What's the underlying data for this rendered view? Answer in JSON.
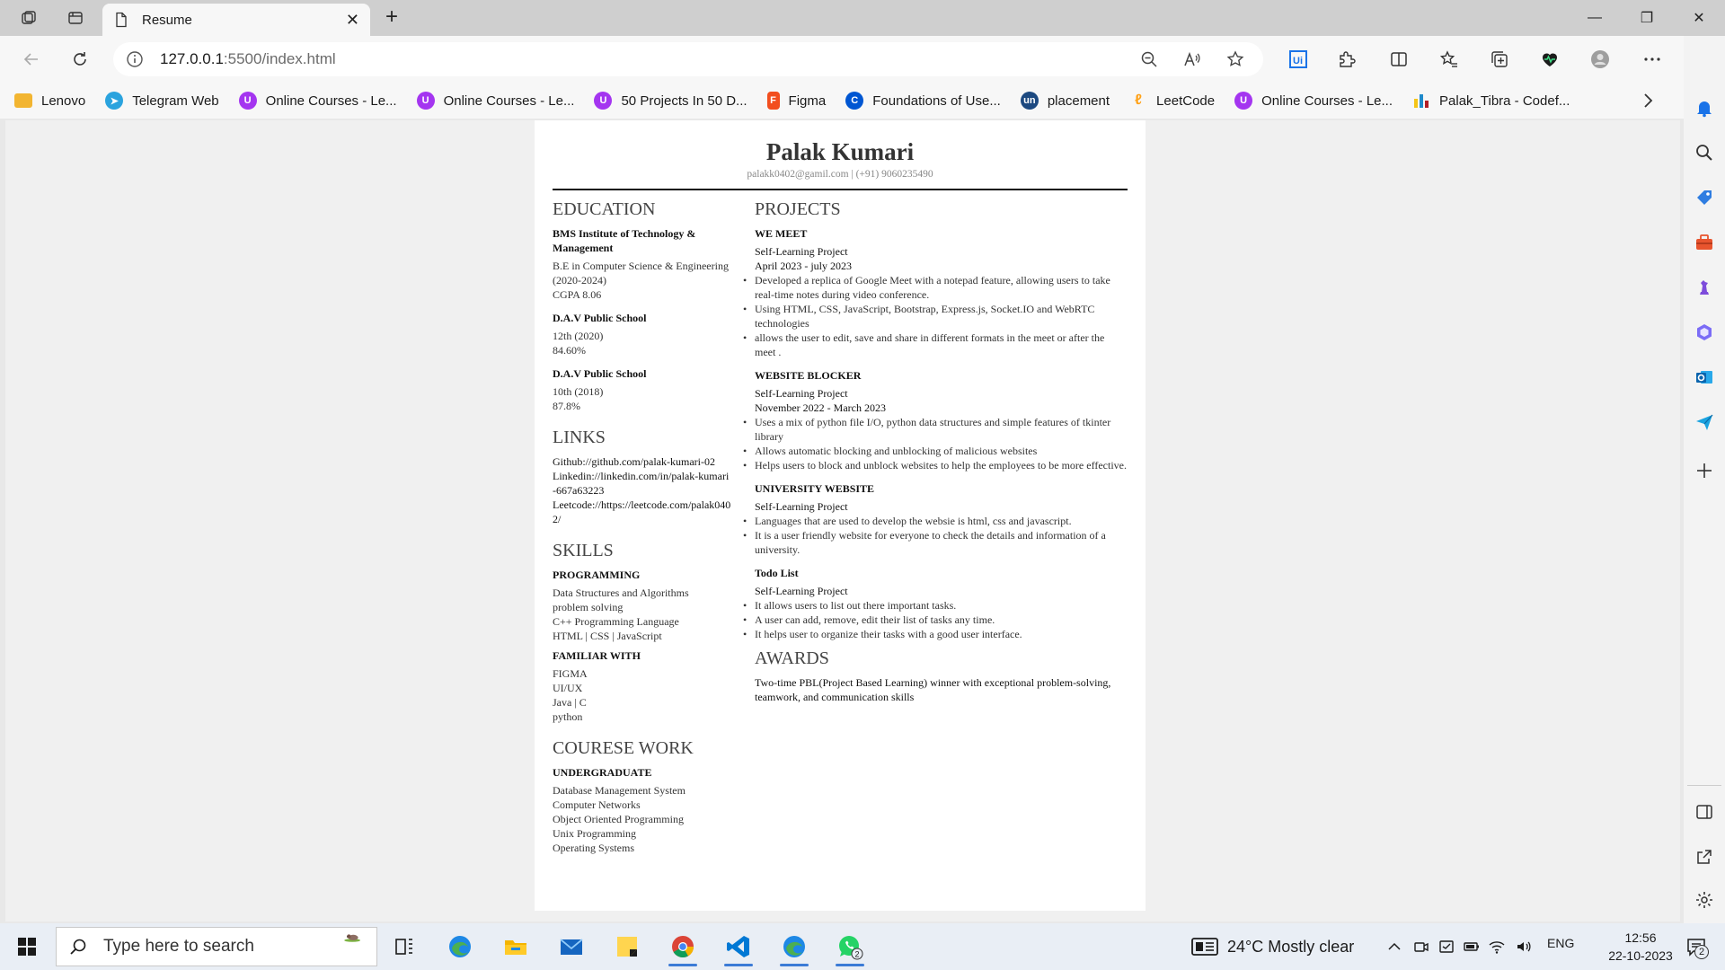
{
  "browser": {
    "tab_title": "Resume",
    "url_host": "127.0.0.1",
    "url_rest": ":5500/index.html",
    "bookmarks": [
      {
        "label": "Lenovo",
        "icon": "folder-icon",
        "color": "#f2b531"
      },
      {
        "label": "Telegram Web",
        "icon": "telegram-icon",
        "color": "#2aa3de"
      },
      {
        "label": "Online Courses - Le...",
        "icon": "udemy-icon",
        "color": "#a435f0"
      },
      {
        "label": "Online Courses - Le...",
        "icon": "udemy-icon",
        "color": "#a435f0"
      },
      {
        "label": "50 Projects In 50 D...",
        "icon": "udemy-icon",
        "color": "#a435f0"
      },
      {
        "label": "Figma",
        "icon": "figma-icon",
        "color": "#f24e1e"
      },
      {
        "label": "Foundations of Use...",
        "icon": "coursera-icon",
        "color": "#0056d2"
      },
      {
        "label": "placement",
        "icon": "unstop-icon",
        "color": "#1c4980"
      },
      {
        "label": "LeetCode",
        "icon": "leetcode-icon",
        "color": "#ffa116"
      },
      {
        "label": "Online Courses - Le...",
        "icon": "udemy-icon",
        "color": "#a435f0"
      },
      {
        "label": "Palak_Tibra - Codef...",
        "icon": "codeforces-icon",
        "color": "#1f8acb"
      }
    ]
  },
  "resume": {
    "name": "Palak Kumari",
    "contact": "palakk0402@gamil.com | (+91) 9060235490",
    "education": {
      "heading": "EDUCATION",
      "items": [
        {
          "school": "BMS Institute of Technology & Management",
          "lines": [
            "B.E in Computer Science & Engineering (2020-2024)",
            "CGPA 8.06"
          ]
        },
        {
          "school": "D.A.V Public School",
          "lines": [
            "12th (2020)",
            "84.60%"
          ]
        },
        {
          "school": "D.A.V Public School",
          "lines": [
            "10th (2018)",
            "87.8%"
          ]
        }
      ]
    },
    "links": {
      "heading": "LINKS",
      "items": [
        "Github://github.com/palak-kumari-02",
        "Linkedin://linkedin.com/in/palak-kumari-667a63223",
        "Leetcode://https://leetcode.com/palak0402/"
      ]
    },
    "skills": {
      "heading": "SKILLS",
      "groups": [
        {
          "title": "PROGRAMMING",
          "items": [
            "Data Structures and Algorithms",
            "problem solving",
            "C++ Programming Language",
            "HTML | CSS | JavaScript"
          ]
        },
        {
          "title": "FAMILIAR WITH",
          "items": [
            "FIGMA",
            "UI/UX",
            "Java | C",
            "python"
          ]
        }
      ]
    },
    "coursework": {
      "heading": "COURESE WORK",
      "title": "UNDERGRADUATE",
      "items": [
        "Database Management System",
        "Computer Networks",
        "Object Oriented Programming",
        "Unix Programming",
        "Operating Systems"
      ]
    },
    "projects": {
      "heading": "PROJECTS",
      "items": [
        {
          "title": "WE MEET",
          "type": "Self-Learning Project",
          "date": "April 2023 - july 2023",
          "bullets": [
            "Developed a replica of Google Meet with a notepad feature, allowing users to take real-time notes during video conference.",
            "Using HTML, CSS, JavaScript, Bootstrap, Express.js, Socket.IO and WebRTC technologies",
            "allows the user to edit, save and share in different formats in the meet or after the meet ."
          ]
        },
        {
          "title": "WEBSITE BLOCKER",
          "type": "Self-Learning Project",
          "date": "November 2022 - March 2023",
          "bullets": [
            "Uses a mix of python file I/O, python data structures and simple features of tkinter library",
            "Allows automatic blocking and unblocking of malicious websites",
            "Helps users to block and unblock websites to help the employees to be more effective."
          ]
        },
        {
          "title": "UNIVERSITY WEBSITE",
          "type": "Self-Learning Project",
          "date": "",
          "bullets": [
            "Languages that are used to develop the websie is html, css and javascript.",
            "It is a user friendly website for everyone to check the details and information of a university."
          ]
        },
        {
          "title": "Todo List",
          "type": "Self-Learning Project",
          "date": "",
          "bullets": [
            "It allows users to list out there important tasks.",
            "A user can add, remove, edit their list of tasks any time.",
            "It helps user to organize their tasks with a good user interface."
          ]
        }
      ]
    },
    "awards": {
      "heading": "AWARDS",
      "text": "Two-time PBL(Project Based Learning) winner with exceptional problem-solving, teamwork, and communication skills"
    }
  },
  "taskbar": {
    "search_placeholder": "Type here to search",
    "weather": "24°C  Mostly clear",
    "lang": "ENG",
    "time": "12:56",
    "date": "22-10-2023",
    "notification_count": "2",
    "whatsapp_badge": "2"
  }
}
